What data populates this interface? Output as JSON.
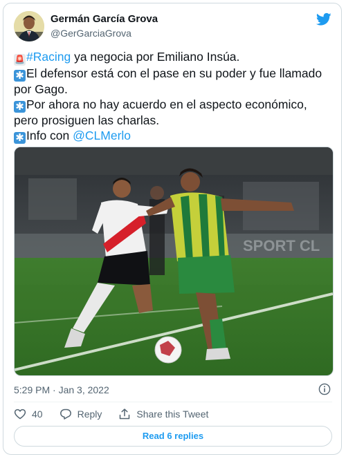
{
  "author": {
    "name": "Germán García Grova",
    "handle": "@GerGarciaGrova",
    "avatar_icon": "profile-photo"
  },
  "tweet": {
    "lines": [
      {
        "emoji": "siren-icon",
        "link": "#Racing",
        "text": " ya negocia por Emiliano Insúa."
      },
      {
        "emoji": "sparkle-icon",
        "text": "El defensor está con el pase en su poder y fue llamado"
      },
      {
        "text": "por Gago."
      },
      {
        "emoji": "sparkle-icon",
        "text": "Por ahora no hay acuerdo en el aspecto económico,"
      },
      {
        "text": "pero prosiguen las charlas."
      },
      {
        "emoji": "sparkle-icon",
        "text": "Info con ",
        "link_after": "@CLMerlo"
      }
    ],
    "photo_description": "two football players fighting for the ball",
    "timestamp": "5:29 PM · Jan 3, 2022"
  },
  "actions": {
    "likes_count": "40",
    "reply_label": "Reply",
    "share_label": "Share this Tweet"
  },
  "read_replies_label": "Read 6 replies",
  "colors": {
    "link": "#1d9bf0",
    "text": "#0f1419",
    "secondary": "#536471",
    "border": "#cfd9de"
  }
}
